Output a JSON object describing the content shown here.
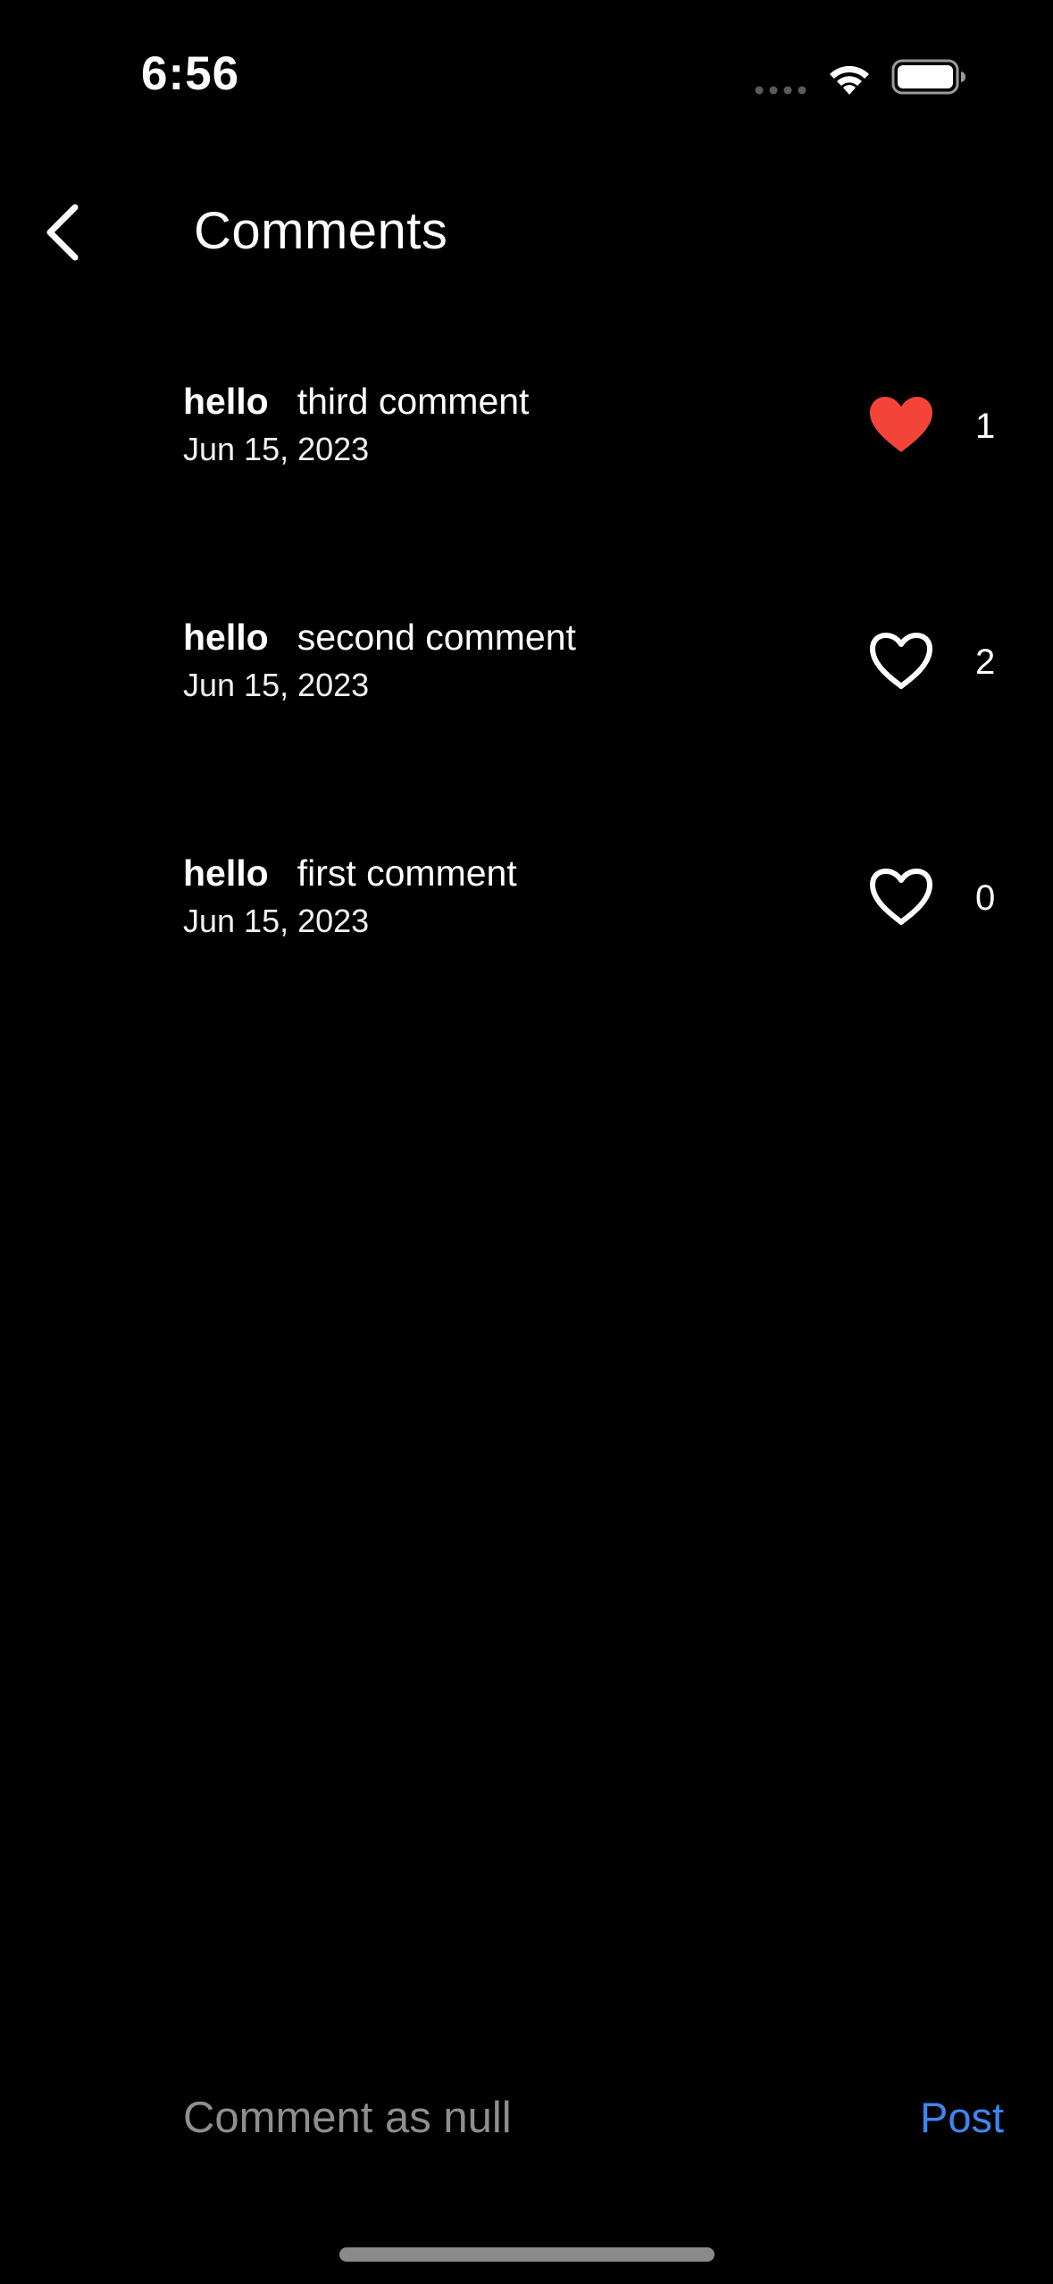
{
  "status_bar": {
    "time": "6:56"
  },
  "header": {
    "title": "Comments",
    "back_icon": "chevron-left-icon"
  },
  "comments": [
    {
      "username": "hello",
      "text": "third comment",
      "date": "Jun 15, 2023",
      "likes": "1",
      "liked": true
    },
    {
      "username": "hello",
      "text": "second comment",
      "date": "Jun 15, 2023",
      "likes": "2",
      "liked": false
    },
    {
      "username": "hello",
      "text": "first comment",
      "date": "Jun 15, 2023",
      "likes": "0",
      "liked": false
    }
  ],
  "composer": {
    "placeholder": "Comment as null",
    "value": "",
    "post_label": "Post"
  },
  "colors": {
    "background": "#000000",
    "liked_heart": "#f4443a",
    "post_accent": "#3d86f0",
    "placeholder": "#8e8e8e"
  }
}
